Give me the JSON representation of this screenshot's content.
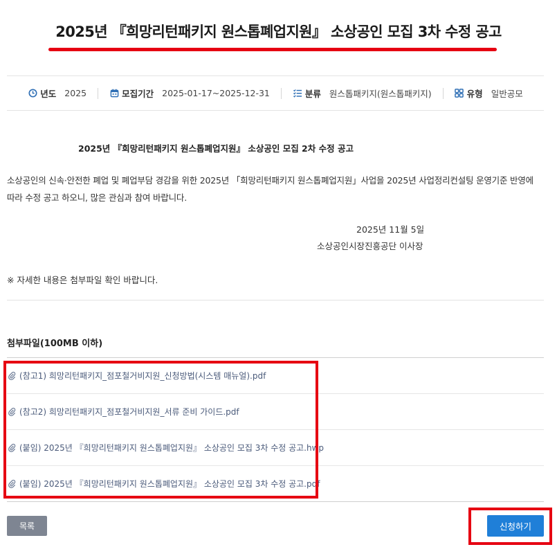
{
  "header": {
    "title": "2025년 『희망리턴패키지 원스톱폐업지원』 소상공인 모집 3차 수정 공고"
  },
  "meta": {
    "year_label": "년도",
    "year_value": "2025",
    "period_label": "모집기간",
    "period_value": "2025-01-17~2025-12-31",
    "category_label": "분류",
    "category_value": "원스톱패키지(원스톱패키지)",
    "type_label": "유형",
    "type_value": "일반공모"
  },
  "content": {
    "subtitle": "2025년 『희망리턴패키지 원스톱폐업지원』 소상공인 모집 2차 수정 공고",
    "body": "소상공인의 신속·안전한 폐업 및 폐업부담 경감을 위한 2025년 「희망리턴패키지 원스톱폐업지원」사업을 2025년 사업정리컨설팅 운영기준 반영에 따라 수정 공고 하오니, 많은 관심과 참여 바랍니다.",
    "date": "2025년 11월 5일",
    "signer": "소상공인시장진흥공단 이사장",
    "note": "※ 자세한 내용은 첨부파일 확인 바랍니다."
  },
  "attachments": {
    "title": "첨부파일(100MB 이하)",
    "files": [
      "(참고1) 희망리턴패키지_점포철거비지원_신청방법(시스템 매뉴얼).pdf",
      "(참고2) 희망리턴패키지_점포철거비지원_서류 준비 가이드.pdf",
      "(붙임) 2025년 『희망리턴패키지 원스톱폐업지원』 소상공인 모집 3차 수정 공고.hwp",
      "(붙임) 2025년 『희망리턴패키지 원스톱폐업지원』 소상공인 모집 3차 수정 공고.pdf"
    ]
  },
  "actions": {
    "list_label": "목록",
    "apply_label": "신청하기"
  },
  "colors": {
    "accent_blue": "#1f7fd8",
    "highlight_red": "#e60012",
    "icon_blue": "#2f6fb5",
    "list_button_gray": "#7e8592"
  }
}
